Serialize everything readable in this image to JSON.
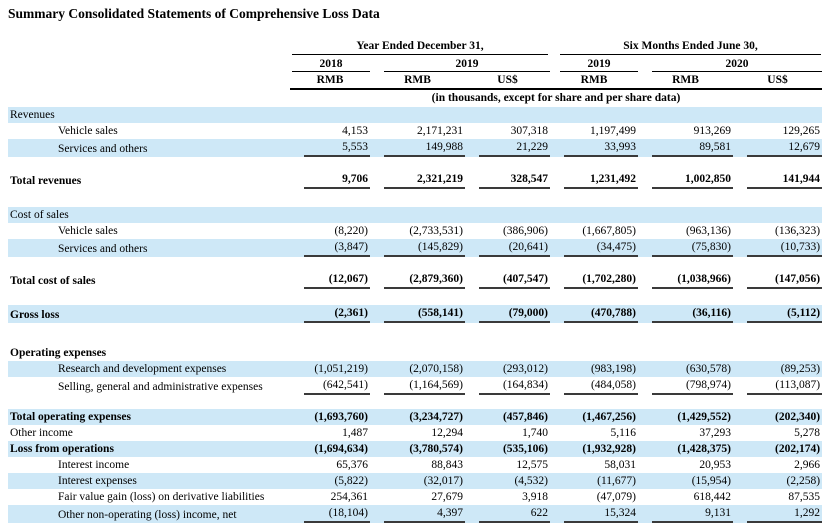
{
  "title": "Summary Consolidated Statements of Comprehensive Loss Data",
  "colors": {
    "row_highlight": "#cee8f7",
    "text": "#000000",
    "rule": "#000000"
  },
  "table": {
    "header": {
      "period_group_1": "Year Ended December 31,",
      "period_group_2": "Six Months Ended June 30,",
      "years": [
        "2018",
        "2019",
        "2019",
        "2020"
      ],
      "currencies": [
        "RMB",
        "RMB",
        "US$",
        "RMB",
        "RMB",
        "US$"
      ],
      "units_note": "(in thousands, except for share and per share data)"
    },
    "rows": [
      {
        "label": "Revenues",
        "indent": 0,
        "bold": false,
        "bg": "blue",
        "underline": false,
        "values": [
          "",
          "",
          "",
          "",
          "",
          ""
        ]
      },
      {
        "label": "Vehicle sales",
        "indent": 1,
        "bold": false,
        "bg": "white",
        "underline": false,
        "values": [
          "4,153",
          "2,171,231",
          "307,318",
          "1,197,499",
          "913,269",
          "129,265"
        ]
      },
      {
        "label": "Services and others",
        "indent": 1,
        "bold": false,
        "bg": "blue",
        "underline": true,
        "values": [
          "5,553",
          "149,988",
          "21,229",
          "33,993",
          "89,581",
          "12,679"
        ]
      },
      {
        "spacer": 14
      },
      {
        "label": "Total revenues",
        "indent": 0,
        "bold": true,
        "bg": "white",
        "underline": true,
        "values": [
          "9,706",
          "2,321,219",
          "328,547",
          "1,231,492",
          "1,002,850",
          "141,944"
        ]
      },
      {
        "spacer": 18
      },
      {
        "label": "Cost of sales",
        "indent": 0,
        "bold": false,
        "bg": "blue",
        "underline": false,
        "values": [
          "",
          "",
          "",
          "",
          "",
          ""
        ]
      },
      {
        "label": "Vehicle sales",
        "indent": 1,
        "bold": false,
        "bg": "white",
        "underline": false,
        "values": [
          "(8,220)",
          "(2,733,531)",
          "(386,906)",
          "(1,667,805)",
          "(963,136)",
          "(136,323)"
        ]
      },
      {
        "label": "Services and others",
        "indent": 1,
        "bold": false,
        "bg": "blue",
        "underline": true,
        "values": [
          "(3,847)",
          "(145,829)",
          "(20,641)",
          "(34,475)",
          "(75,830)",
          "(10,733)"
        ]
      },
      {
        "spacer": 14
      },
      {
        "label": "Total cost of sales",
        "indent": 0,
        "bold": true,
        "bg": "white",
        "underline": true,
        "values": [
          "(12,067)",
          "(2,879,360)",
          "(407,547)",
          "(1,702,280)",
          "(1,038,966)",
          "(147,056)"
        ]
      },
      {
        "spacer": 16
      },
      {
        "label": "Gross loss",
        "indent": 0,
        "bold": true,
        "bg": "blue",
        "underline": true,
        "values": [
          "(2,361)",
          "(558,141)",
          "(79,000)",
          "(470,788)",
          "(36,116)",
          "(5,112)"
        ]
      },
      {
        "spacer": 22
      },
      {
        "label": "Operating expenses",
        "indent": 0,
        "bold": true,
        "bg": "white",
        "underline": false,
        "values": [
          "",
          "",
          "",
          "",
          "",
          ""
        ]
      },
      {
        "label": "Research and development expenses",
        "indent": 1,
        "bold": false,
        "bg": "blue",
        "underline": false,
        "values": [
          "(1,051,219)",
          "(2,070,158)",
          "(293,012)",
          "(983,198)",
          "(630,578)",
          "(89,253)"
        ]
      },
      {
        "label": "Selling, general and administrative expenses",
        "indent": 1,
        "bold": false,
        "bg": "white",
        "underline": true,
        "values": [
          "(642,541)",
          "(1,164,569)",
          "(164,834)",
          "(484,058)",
          "(798,974)",
          "(113,087)"
        ]
      },
      {
        "spacer": 14
      },
      {
        "label": "Total operating expenses",
        "indent": 0,
        "bold": true,
        "bg": "blue",
        "underline": false,
        "values": [
          "(1,693,760)",
          "(3,234,727)",
          "(457,846)",
          "(1,467,256)",
          "(1,429,552)",
          "(202,340)"
        ]
      },
      {
        "label": "Other income",
        "indent": 0,
        "bold": false,
        "bg": "white",
        "underline": false,
        "values": [
          "1,487",
          "12,294",
          "1,740",
          "5,116",
          "37,293",
          "5,278"
        ]
      },
      {
        "label": "Loss from operations",
        "indent": 0,
        "bold": true,
        "bg": "blue",
        "underline": false,
        "values": [
          "(1,694,634)",
          "(3,780,574)",
          "(535,106)",
          "(1,932,928)",
          "(1,428,375)",
          "(202,174)"
        ]
      },
      {
        "label": "Interest income",
        "indent": 1,
        "bold": false,
        "bg": "white",
        "underline": false,
        "values": [
          "65,376",
          "88,843",
          "12,575",
          "58,031",
          "20,953",
          "2,966"
        ]
      },
      {
        "label": "Interest expenses",
        "indent": 1,
        "bold": false,
        "bg": "blue",
        "underline": false,
        "values": [
          "(5,822)",
          "(32,017)",
          "(4,532)",
          "(11,677)",
          "(15,954)",
          "(2,258)"
        ]
      },
      {
        "label": "Fair value gain (loss) on derivative liabilities",
        "indent": 1,
        "bold": false,
        "bg": "white",
        "underline": false,
        "values": [
          "254,361",
          "27,679",
          "3,918",
          "(47,079)",
          "618,442",
          "87,535"
        ]
      },
      {
        "label": "Other non-operating (loss) income, net",
        "indent": 1,
        "bold": false,
        "bg": "blue",
        "underline": true,
        "values": [
          "(18,104)",
          "4,397",
          "622",
          "15,324",
          "9,131",
          "1,292"
        ]
      }
    ]
  }
}
